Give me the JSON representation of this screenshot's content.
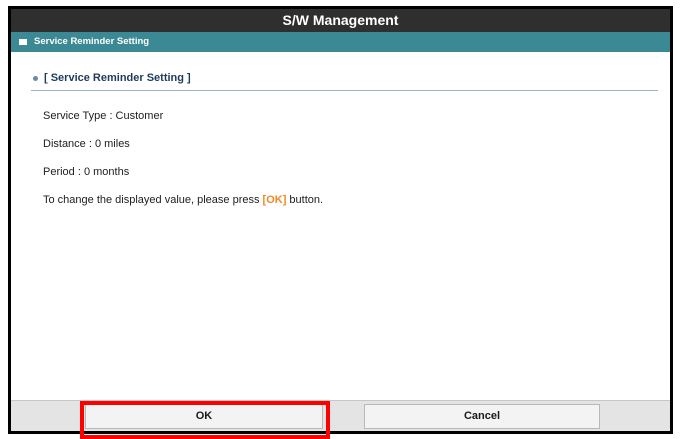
{
  "window": {
    "title": "S/W Management"
  },
  "subheader": {
    "label": "Service Reminder Setting",
    "icon": "panel-icon"
  },
  "section": {
    "heading": "[ Service Reminder Setting ]",
    "icon": "bullet-icon"
  },
  "details": {
    "service_type": "Service Type : Customer",
    "distance": "Distance : 0 miles",
    "period": "Period : 0 months"
  },
  "hint": {
    "prefix": "To change the displayed value, please press ",
    "ok_token": "[OK]",
    "suffix": " button."
  },
  "footer": {
    "ok_label": "OK",
    "cancel_label": "Cancel"
  },
  "colors": {
    "titlebar": "#2f2f2f",
    "subbar": "#3a8994",
    "accent_orange": "#f08a24",
    "highlight_red": "#ff0000"
  }
}
